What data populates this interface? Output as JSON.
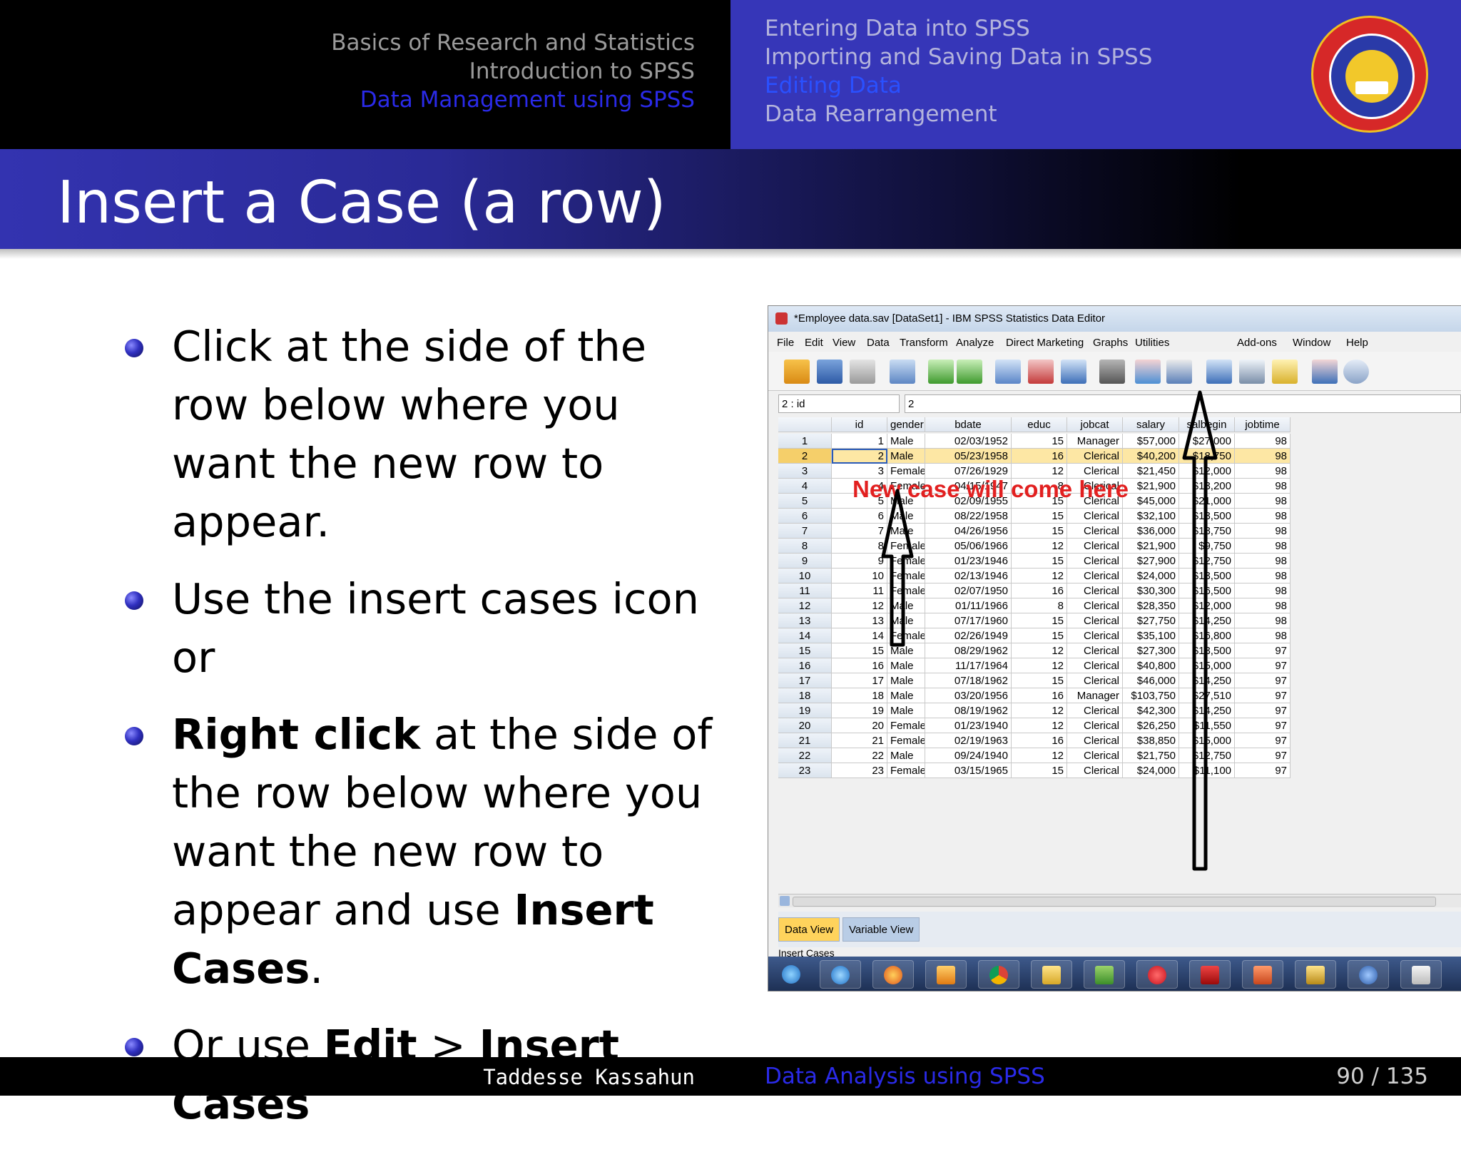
{
  "header": {
    "left_sections": [
      {
        "label": "Basics of Research and Statistics",
        "active": false
      },
      {
        "label": "Introduction to SPSS",
        "active": false
      },
      {
        "label": "Data Management using SPSS",
        "active": true
      }
    ],
    "right_subsections": [
      {
        "label": "Entering Data into SPSS",
        "active": false
      },
      {
        "label": "Importing and Saving Data in SPSS",
        "active": false
      },
      {
        "label": "Editing Data",
        "active": true
      },
      {
        "label": "Data Rearrangement",
        "active": false
      }
    ],
    "logo_icon": "addis-ababa-university-seal"
  },
  "slide": {
    "title": "Insert a Case (a row)",
    "bullets": [
      {
        "parts": [
          {
            "t": "Click at the side of the row below where you want the new row to appear.",
            "b": false
          }
        ]
      },
      {
        "parts": [
          {
            "t": "Use the insert cases icon or",
            "b": false
          }
        ]
      },
      {
        "parts": [
          {
            "t": "Right click",
            "b": true
          },
          {
            "t": " at the side of the row below where you want the new row to appear and use ",
            "b": false
          },
          {
            "t": "Insert Cases",
            "b": true
          },
          {
            "t": ".",
            "b": false
          }
        ]
      },
      {
        "parts": [
          {
            "t": "Or use ",
            "b": false
          },
          {
            "t": "Edit",
            "b": true
          },
          {
            "t": " > ",
            "b": false
          },
          {
            "t": "Insert Cases",
            "b": true
          }
        ]
      }
    ]
  },
  "spss": {
    "window_title": "*Employee data.sav [DataSet1] - IBM SPSS Statistics Data Editor",
    "menu": [
      "File",
      "Edit",
      "View",
      "Data",
      "Transform",
      "Analyze",
      "Direct Marketing",
      "Graphs",
      "Utilities",
      "Add-ons",
      "Window",
      "Help"
    ],
    "toolbar_icons": [
      "open-icon",
      "save-icon",
      "print-icon",
      "dialog-recall-icon",
      "undo-icon",
      "redo-icon",
      "go-to-case-icon",
      "go-to-variable-icon",
      "variables-icon",
      "find-icon",
      "insert-cases-icon",
      "insert-variable-icon",
      "split-file-icon",
      "weight-cases-icon",
      "select-cases-icon",
      "value-labels-icon",
      "use-sets-icon"
    ],
    "cell_ref": "2 : id",
    "cell_value": "2",
    "columns": [
      "id",
      "gender",
      "bdate",
      "educ",
      "jobcat",
      "salary",
      "salbegin",
      "jobtime"
    ],
    "rows": [
      [
        "1",
        "1",
        "Male",
        "02/03/1952",
        "15",
        "Manager",
        "$57,000",
        "$27,000",
        "98"
      ],
      [
        "2",
        "2",
        "Male",
        "05/23/1958",
        "16",
        "Clerical",
        "$40,200",
        "$18,750",
        "98"
      ],
      [
        "3",
        "3",
        "Female",
        "07/26/1929",
        "12",
        "Clerical",
        "$21,450",
        "$12,000",
        "98"
      ],
      [
        "4",
        "4",
        "Female",
        "04/15/1947",
        "8",
        "Clerical",
        "$21,900",
        "$13,200",
        "98"
      ],
      [
        "5",
        "5",
        "Male",
        "02/09/1955",
        "15",
        "Clerical",
        "$45,000",
        "$21,000",
        "98"
      ],
      [
        "6",
        "6",
        "Male",
        "08/22/1958",
        "15",
        "Clerical",
        "$32,100",
        "$13,500",
        "98"
      ],
      [
        "7",
        "7",
        "Male",
        "04/26/1956",
        "15",
        "Clerical",
        "$36,000",
        "$18,750",
        "98"
      ],
      [
        "8",
        "8",
        "Female",
        "05/06/1966",
        "12",
        "Clerical",
        "$21,900",
        "$9,750",
        "98"
      ],
      [
        "9",
        "9",
        "Female",
        "01/23/1946",
        "15",
        "Clerical",
        "$27,900",
        "$12,750",
        "98"
      ],
      [
        "10",
        "10",
        "Female",
        "02/13/1946",
        "12",
        "Clerical",
        "$24,000",
        "$13,500",
        "98"
      ],
      [
        "11",
        "11",
        "Female",
        "02/07/1950",
        "16",
        "Clerical",
        "$30,300",
        "$16,500",
        "98"
      ],
      [
        "12",
        "12",
        "Male",
        "01/11/1966",
        "8",
        "Clerical",
        "$28,350",
        "$12,000",
        "98"
      ],
      [
        "13",
        "13",
        "Male",
        "07/17/1960",
        "15",
        "Clerical",
        "$27,750",
        "$14,250",
        "98"
      ],
      [
        "14",
        "14",
        "Female",
        "02/26/1949",
        "15",
        "Clerical",
        "$35,100",
        "$16,800",
        "98"
      ],
      [
        "15",
        "15",
        "Male",
        "08/29/1962",
        "12",
        "Clerical",
        "$27,300",
        "$13,500",
        "97"
      ],
      [
        "16",
        "16",
        "Male",
        "11/17/1964",
        "12",
        "Clerical",
        "$40,800",
        "$15,000",
        "97"
      ],
      [
        "17",
        "17",
        "Male",
        "07/18/1962",
        "15",
        "Clerical",
        "$46,000",
        "$14,250",
        "97"
      ],
      [
        "18",
        "18",
        "Male",
        "03/20/1956",
        "16",
        "Manager",
        "$103,750",
        "$27,510",
        "97"
      ],
      [
        "19",
        "19",
        "Male",
        "08/19/1962",
        "12",
        "Clerical",
        "$42,300",
        "$14,250",
        "97"
      ],
      [
        "20",
        "20",
        "Female",
        "01/23/1940",
        "12",
        "Clerical",
        "$26,250",
        "$11,550",
        "97"
      ],
      [
        "21",
        "21",
        "Female",
        "02/19/1963",
        "16",
        "Clerical",
        "$38,850",
        "$15,000",
        "97"
      ],
      [
        "22",
        "22",
        "Male",
        "09/24/1940",
        "12",
        "Clerical",
        "$21,750",
        "$12,750",
        "97"
      ],
      [
        "23",
        "23",
        "Female",
        "03/15/1965",
        "15",
        "Clerical",
        "$24,000",
        "$11,100",
        "97"
      ]
    ],
    "selected_row": 2,
    "tabs": [
      {
        "label": "Data View",
        "active": true
      },
      {
        "label": "Variable View",
        "active": false
      }
    ],
    "status": "Insert Cases",
    "annotation": "New case will come here",
    "taskbar_icons": [
      "start-orb-icon",
      "internet-explorer-icon",
      "firefox-icon",
      "media-player-icon",
      "chrome-icon",
      "file-explorer-icon",
      "app-icon",
      "opera-icon",
      "acrobat-icon",
      "powerpoint-icon",
      "word-icon",
      "spss-icon",
      "tex-icon"
    ],
    "colors": {
      "selected_row": "#fde7a4",
      "annotation": "#e22020"
    }
  },
  "footer": {
    "author": "Taddesse Kassahun",
    "short_title": "Data Analysis using SPSS",
    "page": "90 / 135"
  }
}
